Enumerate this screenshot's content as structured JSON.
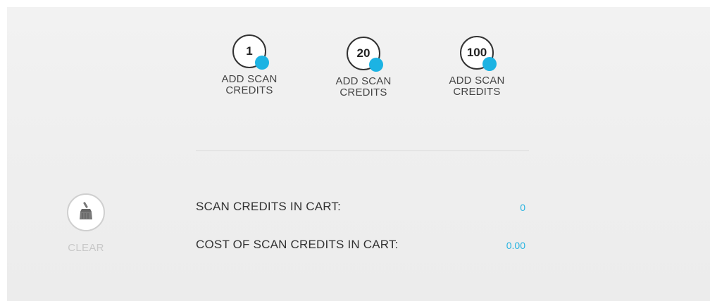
{
  "credit_options": [
    {
      "amount": "1",
      "label_line1": "ADD SCAN",
      "label_line2": "CREDITS"
    },
    {
      "amount": "20",
      "label_line1": "ADD SCAN",
      "label_line2": "CREDITS"
    },
    {
      "amount": "100",
      "label_line1": "ADD SCAN",
      "label_line2": "CREDITS"
    }
  ],
  "clear": {
    "label": "CLEAR",
    "icon": "broom-icon"
  },
  "summary": {
    "credits_label": "SCAN CREDITS IN CART:",
    "credits_value": "0",
    "cost_label": "COST OF SCAN CREDITS IN CART:",
    "cost_value": "0.00"
  },
  "colors": {
    "accent": "#1cb3e3",
    "value_text": "#27b3e0",
    "muted_text": "#c8c8c8"
  }
}
